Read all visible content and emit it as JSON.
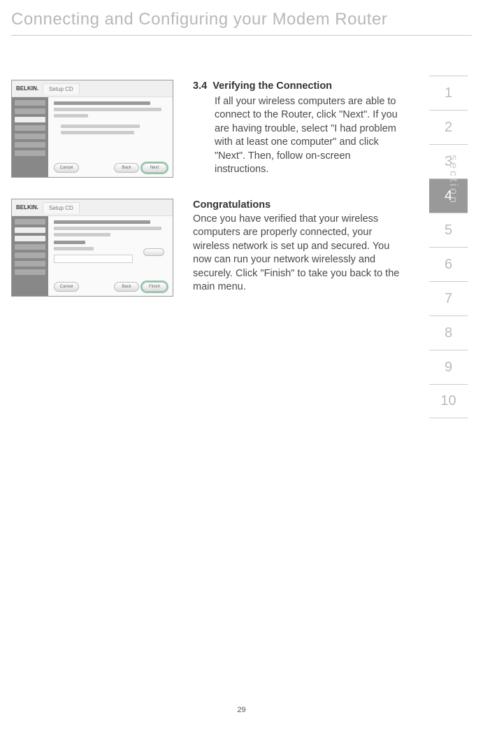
{
  "page": {
    "title": "Connecting and Configuring your Modem Router",
    "number": "29"
  },
  "sectionNav": {
    "label": "section",
    "items": [
      "1",
      "2",
      "3",
      "4",
      "5",
      "6",
      "7",
      "8",
      "9",
      "10"
    ],
    "activeIndex": 3
  },
  "screenshots": {
    "logo": "BELKIN.",
    "tab": "Setup CD",
    "btnCancel": "Cancel",
    "btnBack": "Back",
    "btnNext": "Next",
    "btnFinish": "Finish"
  },
  "step34": {
    "number": "3.4",
    "title": "Verifying the Connection",
    "body": "If all your wireless computers are able to connect to the Router, click \"Next\". If you are having trouble, select \"I had problem with at least one computer\" and click \"Next\". Then, follow on-screen instructions."
  },
  "congrats": {
    "title": "Congratulations",
    "body": "Once you have verified that your wireless computers are properly connected, your wireless network is set up and secured. You now can run your network wirelessly and securely. Click \"Finish\" to take you back to the main menu."
  }
}
